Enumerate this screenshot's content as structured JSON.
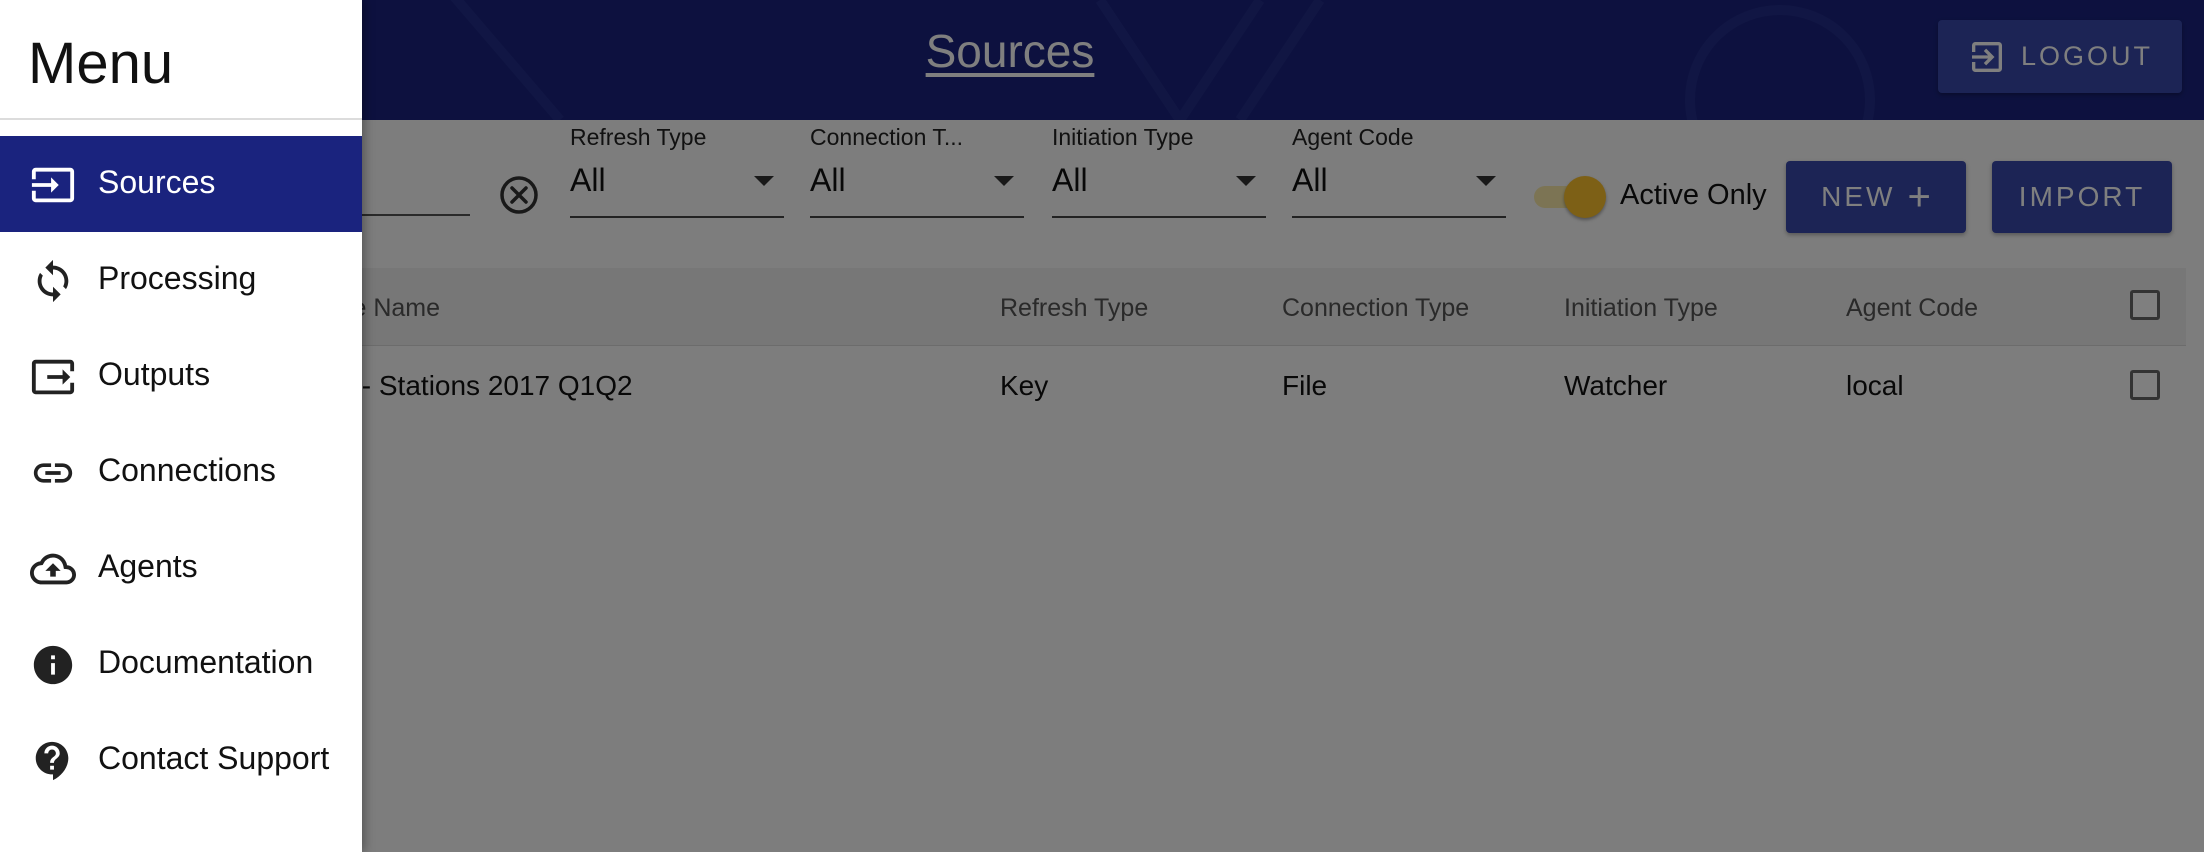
{
  "header": {
    "title": "Sources",
    "logout_label": "LOGOUT"
  },
  "toolbar": {
    "filters": [
      {
        "label": "Refresh Type",
        "value": "All"
      },
      {
        "label": "Connection T...",
        "value": "All"
      },
      {
        "label": "Initiation Type",
        "value": "All"
      },
      {
        "label": "Agent Code",
        "value": "All"
      }
    ],
    "active_only": {
      "label": "Active Only",
      "on": true
    },
    "new_label": "NEW",
    "new_icon": "+",
    "import_label": "IMPORT"
  },
  "table": {
    "columns": [
      "ce Name",
      "Refresh Type",
      "Connection Type",
      "Initiation Type",
      "Agent Code"
    ],
    "rows": [
      [
        "y - Stations 2017 Q1Q2",
        "Key",
        "File",
        "Watcher",
        "local"
      ]
    ]
  },
  "drawer": {
    "title": "Menu",
    "items": [
      {
        "label": "Sources",
        "icon": "input-arrow-icon",
        "active": true
      },
      {
        "label": "Processing",
        "icon": "sync-icon"
      },
      {
        "label": "Outputs",
        "icon": "output-arrow-icon"
      },
      {
        "label": "Connections",
        "icon": "link-icon"
      },
      {
        "label": "Agents",
        "icon": "cloud-upload-icon"
      },
      {
        "label": "Documentation",
        "icon": "info-icon"
      },
      {
        "label": "Contact Support",
        "icon": "help-bubble-icon"
      }
    ]
  },
  "colors": {
    "primary": "#1a237e",
    "button": "#3949ab",
    "toggle": "#fbc02d"
  }
}
